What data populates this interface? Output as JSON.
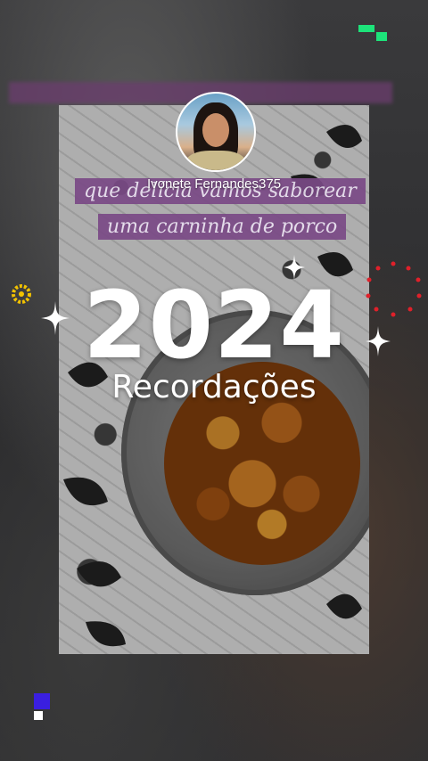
{
  "post": {
    "username": "Ivonete Fernandes375",
    "caption_line1": "que delícia vamos saborear",
    "caption_line2": "uma carninha de porco",
    "year": "2024",
    "subtitle": "Recordações"
  },
  "colors": {
    "caption_bg": "#7a4a86",
    "logo_green": "#1de37a",
    "logo_blue": "#3a1fe0",
    "ring_red": "#e0202a",
    "ring_yellow": "#f2c200"
  },
  "icons": [
    "avatar",
    "sparkle-icon",
    "yellow-ring-icon",
    "red-dot-ring-icon",
    "brand-logo-icon"
  ]
}
